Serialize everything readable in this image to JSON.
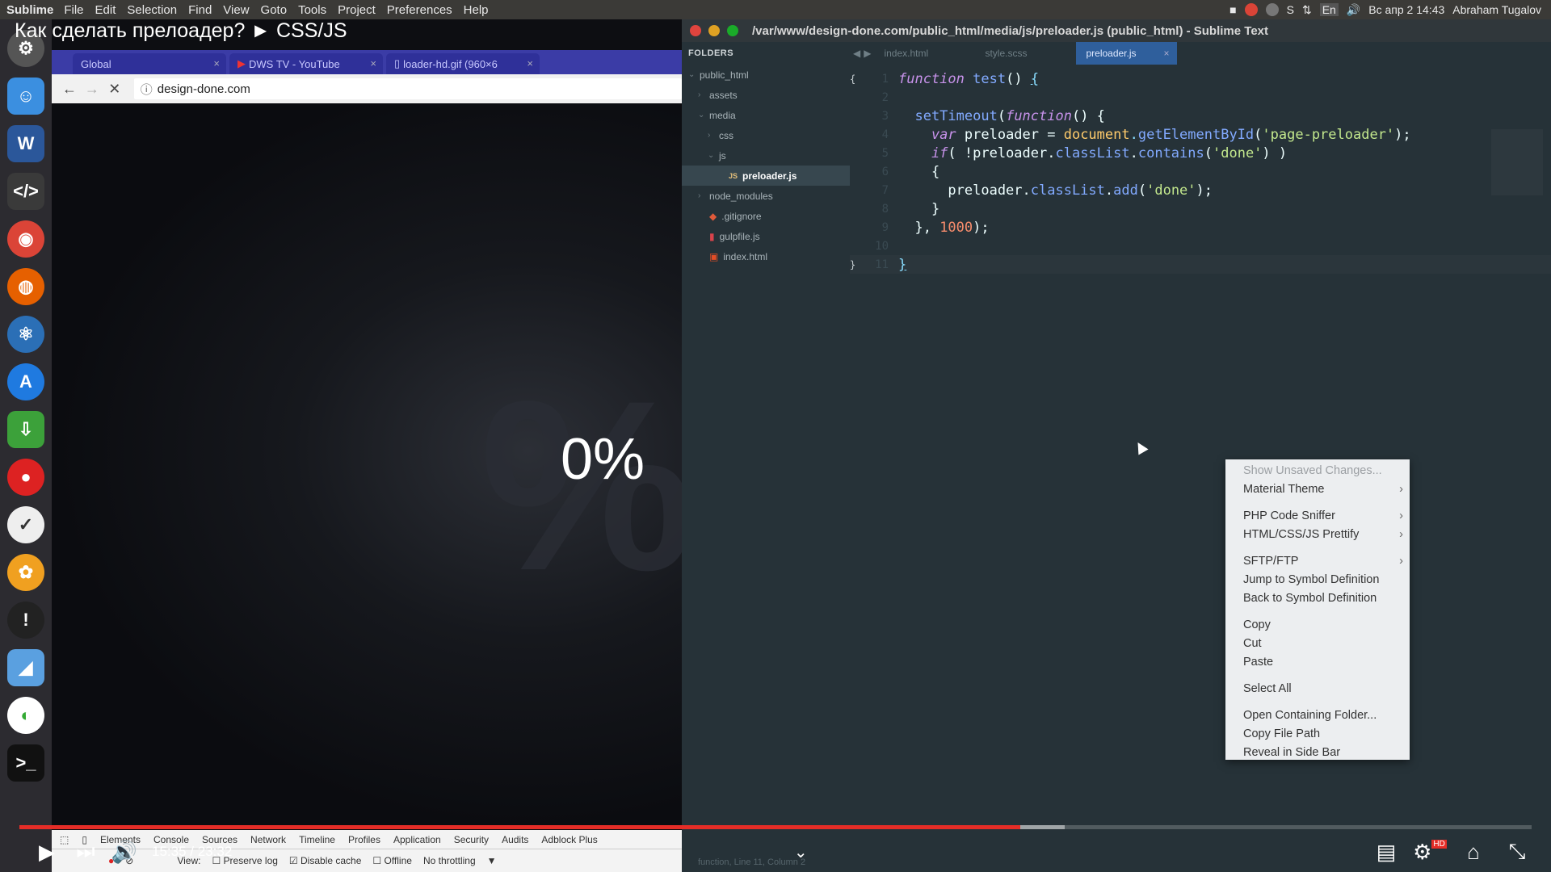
{
  "topbar": {
    "app": "Sublime",
    "menu": [
      "File",
      "Edit",
      "Selection",
      "Find",
      "View",
      "Goto",
      "Tools",
      "Project",
      "Preferences",
      "Help"
    ],
    "lang": "En",
    "clock": "Вс апр  2 14:43",
    "user": "Abraham Tugalov"
  },
  "video": {
    "title": "Как сделать прелоадер? ► CSS/JS",
    "time": "15:35 / 23:32",
    "hd_badge": "HD"
  },
  "browser": {
    "tabs": [
      {
        "label": "Global"
      },
      {
        "label": "DWS TV - YouTube"
      },
      {
        "label": "loader-hd.gif (960×6"
      }
    ],
    "url": "design-done.com",
    "percent": "0%",
    "devtools": {
      "tabs": [
        "Elements",
        "Console",
        "Sources",
        "Network",
        "Timeline",
        "Profiles",
        "Application",
        "Security",
        "Audits",
        "Adblock Plus"
      ],
      "view_label": "View:",
      "preserve_log": "Preserve log",
      "disable_cache": "Disable cache",
      "offline": "Offline",
      "throttling": "No throttling"
    }
  },
  "sublime": {
    "title": "/var/www/design-done.com/public_html/media/js/preloader.js (public_html) - Sublime Text",
    "folders_label": "FOLDERS",
    "tree": [
      {
        "label": "public_html",
        "arrow": "v"
      },
      {
        "label": "assets",
        "arrow": ">"
      },
      {
        "label": "media",
        "arrow": "v"
      },
      {
        "label": "css",
        "arrow": ">"
      },
      {
        "label": "js",
        "arrow": "v"
      },
      {
        "label": "preloader.js",
        "arrow": "JS"
      },
      {
        "label": "node_modules",
        "arrow": ">"
      },
      {
        "label": ".gitignore",
        "arrow": "◆"
      },
      {
        "label": "gulpfile.js",
        "arrow": "▮"
      },
      {
        "label": "index.html",
        "arrow": "▣"
      }
    ],
    "tabs": [
      "index.html",
      "style.scss",
      "preloader.js"
    ],
    "line_numbers": [
      "1",
      "2",
      "3",
      "4",
      "5",
      "6",
      "7",
      "8",
      "9",
      "10",
      "11"
    ],
    "status": "function, Line 11, Column 2"
  },
  "context_menu": {
    "items": [
      {
        "label": "Show Unsaved Changes...",
        "disabled": true
      },
      {
        "label": "Material Theme",
        "submenu": true
      },
      {
        "label": "PHP Code Sniffer",
        "submenu": true
      },
      {
        "label": "HTML/CSS/JS Prettify",
        "submenu": true
      },
      {
        "label": "SFTP/FTP",
        "submenu": true
      },
      {
        "label": "Jump to Symbol Definition"
      },
      {
        "label": "Back to Symbol Definition"
      },
      {
        "label": "Copy"
      },
      {
        "label": "Cut"
      },
      {
        "label": "Paste"
      },
      {
        "label": "Select All"
      },
      {
        "label": "Open Containing Folder..."
      },
      {
        "label": "Copy File Path"
      },
      {
        "label": "Reveal in Side Bar"
      }
    ]
  },
  "colors": {
    "accent_red": "#e52d27",
    "sublime_bg": "#263238",
    "active_tab": "#2f5f9c"
  },
  "progress": {
    "played_fraction": 0.662
  }
}
